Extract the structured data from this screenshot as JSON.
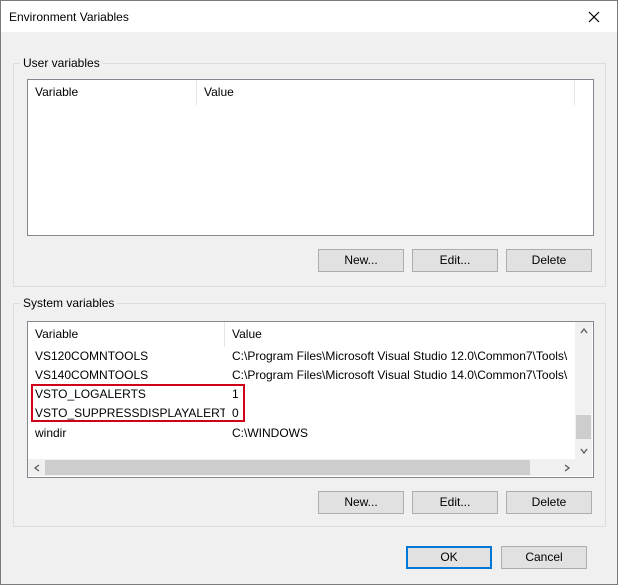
{
  "window": {
    "title": "Environment Variables"
  },
  "user_group": {
    "label": "User variables",
    "columns": [
      "Variable",
      "Value"
    ],
    "rows": [],
    "buttons": {
      "new": "New...",
      "edit": "Edit...",
      "delete": "Delete"
    }
  },
  "system_group": {
    "label": "System variables",
    "columns": [
      "Variable",
      "Value"
    ],
    "rows": [
      {
        "variable": "VS120COMNTOOLS",
        "value": "C:\\Program Files\\Microsoft Visual Studio 12.0\\Common7\\Tools\\"
      },
      {
        "variable": "VS140COMNTOOLS",
        "value": "C:\\Program Files\\Microsoft Visual Studio 14.0\\Common7\\Tools\\"
      },
      {
        "variable": "VSTO_LOGALERTS",
        "value": "1"
      },
      {
        "variable": "VSTO_SUPPRESSDISPLAYALERTS",
        "value": "0"
      },
      {
        "variable": "windir",
        "value": "C:\\WINDOWS"
      }
    ],
    "highlighted_rows": [
      "VSTO_LOGALERTS",
      "VSTO_SUPPRESSDISPLAYALERTS"
    ],
    "buttons": {
      "new": "New...",
      "edit": "Edit...",
      "delete": "Delete"
    }
  },
  "footer": {
    "ok": "OK",
    "cancel": "Cancel"
  },
  "colors": {
    "highlight": "#d0021b",
    "default_button_border": "#0078d7"
  },
  "icons": [
    "close-icon",
    "scroll-up-arrow-icon",
    "scroll-down-arrow-icon",
    "scroll-left-arrow-icon",
    "scroll-right-arrow-icon"
  ]
}
